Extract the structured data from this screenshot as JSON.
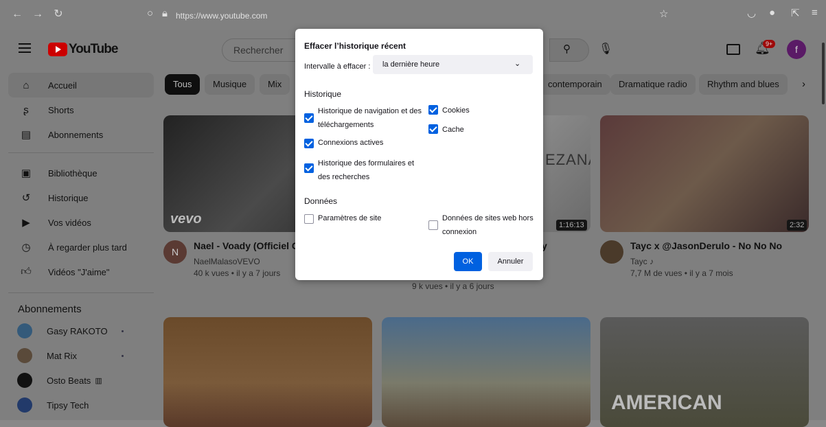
{
  "browser": {
    "url": "https://www.youtube.com"
  },
  "youtube": {
    "logo_text": "YouTube",
    "search_placeholder": "Rechercher",
    "notif_badge": "9+",
    "avatar_letter": "f",
    "chips": [
      "Tous",
      "Musique",
      "Mix",
      "contemporain",
      "Dramatique radio",
      "Rhythm and blues"
    ],
    "sidebar": {
      "main": [
        {
          "label": "Accueil",
          "icon": "home-icon"
        },
        {
          "label": "Shorts",
          "icon": "shorts-icon"
        },
        {
          "label": "Abonnements",
          "icon": "subscriptions-icon"
        }
      ],
      "library": [
        {
          "label": "Bibliothèque",
          "icon": "library-icon"
        },
        {
          "label": "Historique",
          "icon": "history-icon"
        },
        {
          "label": "Vos vidéos",
          "icon": "your-videos-icon"
        },
        {
          "label": "À regarder plus tard",
          "icon": "watch-later-icon"
        },
        {
          "label": "Vidéos \"J'aime\"",
          "icon": "like-icon"
        }
      ],
      "subs_title": "Abonnements",
      "subscriptions": [
        {
          "label": "Gasy RAKOTO"
        },
        {
          "label": "Mat Rix"
        },
        {
          "label": "Osto Beats"
        },
        {
          "label": "Tipsy Tech"
        }
      ]
    },
    "videos": [
      {
        "title": "Nael - Voady (Officiel Cl",
        "channel": "NaelMalasoVEVO",
        "meta": "40 k vues • il y a 7 jours",
        "avatar": "N",
        "overlay": "vevo"
      },
      {
        "title": "y",
        "meta": "9 k vues • il y a 6 jours",
        "duration": "1:16:13",
        "overlay": "EZANA"
      },
      {
        "title": "Tayc x @JasonDerulo - No No No",
        "channel": "Tayc",
        "meta": "7,7 M de vues • il y a 7 mois",
        "duration": "2:32"
      }
    ],
    "bottom_overlay": "AMERICAN"
  },
  "dialog": {
    "title": "Effacer l’historique récent",
    "interval_label": "Intervalle à effacer :",
    "interval_value": "la dernière heure",
    "history_title": "Historique",
    "history_items": [
      {
        "label": "Historique de navigation et des téléchargements",
        "checked": true
      },
      {
        "label": "Connexions actives",
        "checked": true
      },
      {
        "label": "Historique des formulaires et des recherches",
        "checked": true
      },
      {
        "label": "Cookies",
        "checked": true
      },
      {
        "label": "Cache",
        "checked": true
      }
    ],
    "data_title": "Données",
    "data_items": [
      {
        "label": "Paramètres de site",
        "checked": false
      },
      {
        "label": "Données de sites web hors connexion",
        "checked": false
      }
    ],
    "ok_label": "OK",
    "cancel_label": "Annuler"
  }
}
